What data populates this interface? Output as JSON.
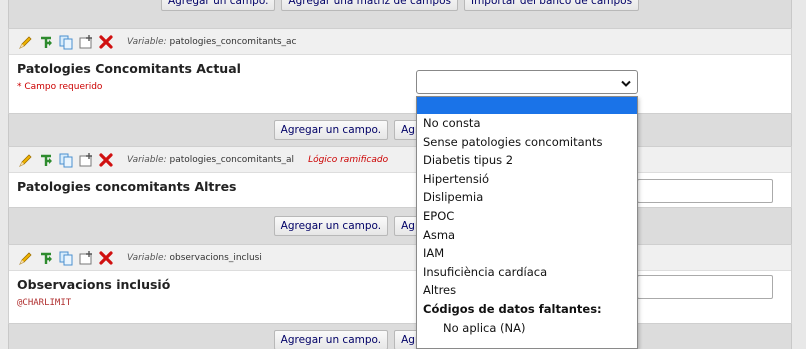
{
  "top_toolbar": {
    "add_field": "Agregar un campo.",
    "add_matrix": "Agregar una matriz de campos",
    "import_bank": "Importar del banco de campos"
  },
  "fields": [
    {
      "variable_prefix": "Variable:",
      "variable_name": "patologies_concomitants_ac",
      "label": "Patologies Concomitants Actual",
      "required_note": "* Campo requerido"
    },
    {
      "variable_prefix": "Variable:",
      "variable_name": "patologies_concomitants_al",
      "logic_label": "Lógico ramificado",
      "label": "Patologies concomitants Altres"
    },
    {
      "variable_prefix": "Variable:",
      "variable_name": "observacions_inclusi",
      "label": "Observacions inclusió",
      "action_tag": "@CHARLIMIT"
    }
  ],
  "between_toolbar": {
    "add_field": "Agregar un campo.",
    "add_matrix": "Agregar una matriz de"
  },
  "dropdown": {
    "selected_value": "",
    "options": [
      "No consta",
      "Sense patologies concomitants",
      "Diabetis tipus 2",
      "Hipertensió",
      "Dislipemia",
      "EPOC",
      "Asma",
      "IAM",
      "Insuficiència cardíaca",
      "Altres"
    ],
    "missing_group_label": "Códigos de datos faltantes:",
    "missing_options": [
      "No aplica (NA)"
    ]
  },
  "colors": {
    "accent": "#1a73e8",
    "required": "#cc0000",
    "button_text": "#000066"
  }
}
